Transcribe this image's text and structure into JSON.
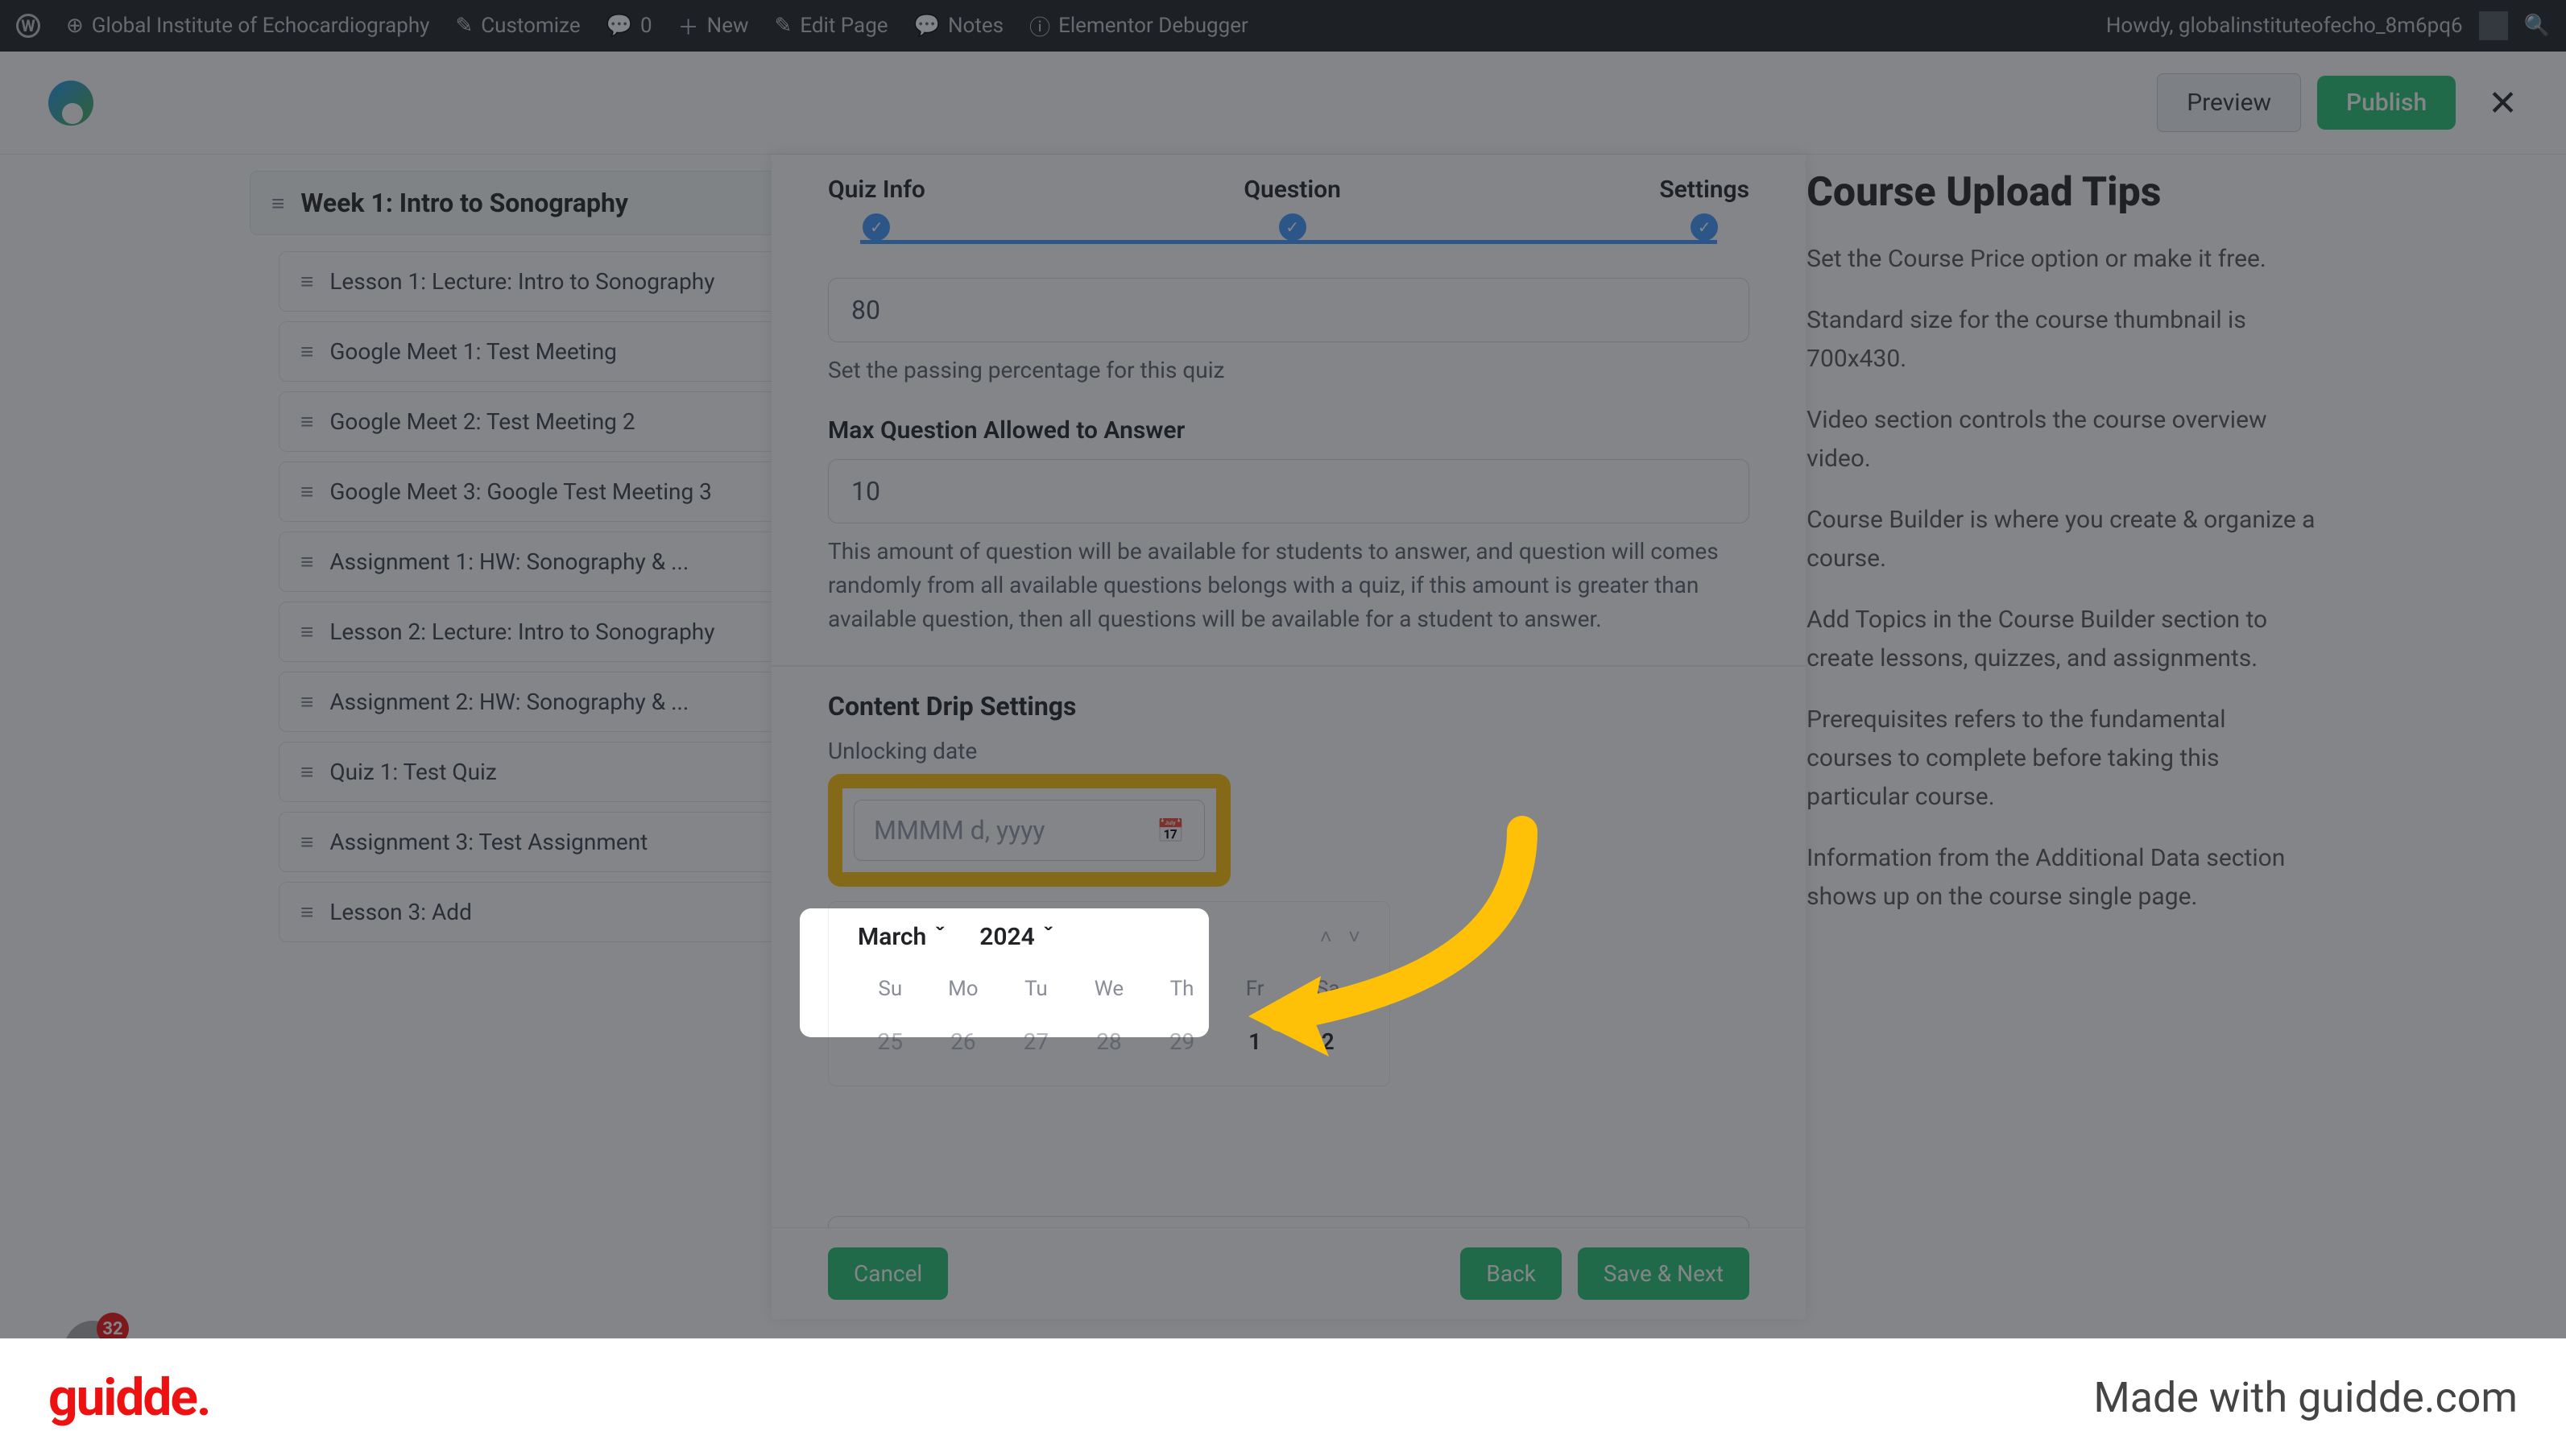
{
  "adminbar": {
    "site": "Global Institute of Echocardiography",
    "customize": "Customize",
    "comments": "0",
    "new": "New",
    "edit": "Edit Page",
    "notes": "Notes",
    "debugger": "Elementor Debugger",
    "howdy": "Howdy, globalinstituteofecho_8m6pq6"
  },
  "topbar": {
    "preview": "Preview",
    "publish": "Publish"
  },
  "sidebar": {
    "week": "Week 1: Intro to Sonography",
    "items": [
      "Lesson 1: Lecture: Intro to Sonography",
      "Google Meet 1: Test Meeting",
      "Google Meet 2: Test Meeting 2",
      "Google Meet 3: Google Test Meeting 3",
      "Assignment 1: HW: Sonography & ...",
      "Lesson 2: Lecture: Intro to Sonography",
      "Assignment 2: HW: Sonography & ...",
      "Quiz 1: Test Quiz",
      "Assignment 3: Test Assignment",
      "Lesson 3: Add"
    ]
  },
  "tips": {
    "title": "Course Upload Tips",
    "p1": "Set the Course Price option or make it free.",
    "p2": "Standard size for the course thumbnail is 700x430.",
    "p3": "Video section controls the course overview video.",
    "p4": "Course Builder is where you create & organize a course.",
    "p5": "Add Topics in the Course Builder section to create lessons, quizzes, and assignments.",
    "p6": "Prerequisites refers to the fundamental courses to complete before taking this particular course.",
    "p7": "Information from the Additional Data section shows up on the course single page."
  },
  "modal": {
    "steps": {
      "s1": "Quiz Info",
      "s2": "Question",
      "s3": "Settings"
    },
    "passing": "80",
    "passing_help": "Set the passing percentage for this quiz",
    "maxq_label": "Max Question Allowed to Answer",
    "maxq": "10",
    "maxq_help": "This amount of question will be available for students to answer, and question will comes randomly from all available questions belongs with a quiz, if this amount is greater than available question, then all questions will be available for a student to answer.",
    "drip_title": "Content Drip Settings",
    "unlock_label": "Unlocking date",
    "date_placeholder": "MMMM d, yyyy",
    "month": "March",
    "year": "2024",
    "dow": [
      "Su",
      "Mo",
      "Tu",
      "We",
      "Th",
      "Fr",
      "Sa"
    ],
    "days": [
      {
        "n": "25",
        "a": false
      },
      {
        "n": "26",
        "a": false
      },
      {
        "n": "27",
        "a": false
      },
      {
        "n": "28",
        "a": false
      },
      {
        "n": "29",
        "a": false
      },
      {
        "n": "1",
        "a": true
      },
      {
        "n": "2",
        "a": true
      }
    ],
    "cancel": "Cancel",
    "back": "Back",
    "save": "Save & Next"
  },
  "badge": "32",
  "footer": {
    "logo": "guidde.",
    "made": "Made with guidde.com"
  }
}
